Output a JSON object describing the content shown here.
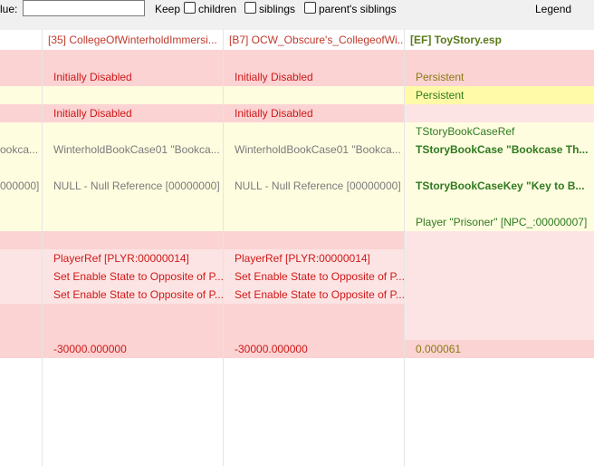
{
  "toolbar": {
    "filter_label": "lue:",
    "filter_value": "",
    "keep_label": "Keep",
    "children_label": "children",
    "siblings_label": "siblings",
    "parents_siblings_label": "parent's siblings",
    "legend_button": "Legend"
  },
  "columns": [
    {
      "label": "[35] CollegeOfWinterholdImmersi...",
      "color": "#c0392b"
    },
    {
      "label": "[B7] OCW_Obscure's_CollegeofWi...",
      "color": "#c0392b"
    },
    {
      "label": "[EF] ToyStory.esp",
      "color": "#5a7a1a"
    }
  ],
  "rows": [
    {
      "bg": "#fbd3d3",
      "cells": [
        "",
        "",
        "",
        ""
      ]
    },
    {
      "bg": "#fbd3d3",
      "cells": [
        "",
        "Initially Disabled",
        "Initially Disabled",
        "Persistent"
      ],
      "styles": [
        "",
        "t-red",
        "t-red",
        "t-olive"
      ],
      "bg3": "#fbd3d3"
    },
    {
      "bg": "#fffde0",
      "cells": [
        "",
        "",
        "",
        "Persistent"
      ],
      "styles": [
        "",
        "",
        "",
        "t-green"
      ],
      "bg3": "#fffaa8"
    },
    {
      "bg": "#fbd3d3",
      "cells": [
        "",
        "Initially Disabled",
        "Initially Disabled",
        ""
      ],
      "styles": [
        "",
        "t-red",
        "t-red",
        ""
      ],
      "bg3": "#fde4e4"
    },
    {
      "bg": "#fffde0",
      "cells": [
        "",
        "",
        "",
        "TStoryBookCaseRef"
      ],
      "styles": [
        "",
        "",
        "",
        "t-green"
      ],
      "bg3": "#fffde0"
    },
    {
      "bg": "#fffde0",
      "cells": [
        "ookca...",
        "WinterholdBookCase01 \"Bookca...",
        "WinterholdBookCase01 \"Bookca...",
        "TStoryBookCase \"Bookcase Th..."
      ],
      "styles": [
        "t-gray",
        "t-gray",
        "t-gray",
        "t-green-b"
      ],
      "bg3": "#fffde0",
      "dotted": true
    },
    {
      "bg": "#fffde0",
      "cells": [
        "",
        "",
        "",
        ""
      ],
      "bg3": "#fffde0"
    },
    {
      "bg": "#fffde0",
      "cells": [
        "000000]",
        "NULL - Null Reference [00000000]",
        "NULL - Null Reference [00000000]",
        "TStoryBookCaseKey \"Key to B..."
      ],
      "styles": [
        "t-gray",
        "t-gray",
        "t-gray",
        "t-green-b"
      ],
      "bg3": "#fffde0",
      "dotted": true
    },
    {
      "bg": "#fffde0",
      "cells": [
        "",
        "",
        "",
        ""
      ],
      "bg3": "#fffde0"
    },
    {
      "bg": "#fffde0",
      "cells": [
        "",
        "",
        "",
        "Player \"Prisoner\" [NPC_:00000007]"
      ],
      "styles": [
        "",
        "",
        "",
        "t-green"
      ],
      "bg3": "#fffde0"
    },
    {
      "bg": "#fbd3d3",
      "cells": [
        "",
        "",
        "",
        ""
      ],
      "bg3": "#fde4e4"
    },
    {
      "bg": "#fde4e4",
      "cells": [
        "",
        "PlayerRef [PLYR:00000014]",
        "PlayerRef [PLYR:00000014]",
        ""
      ],
      "styles": [
        "",
        "t-red",
        "t-red",
        ""
      ],
      "bg3": "#fde4e4"
    },
    {
      "bg": "#fde4e4",
      "cells": [
        "",
        "Set Enable State to Opposite of P...",
        "Set Enable State to Opposite of P...",
        ""
      ],
      "styles": [
        "",
        "t-red",
        "t-red",
        ""
      ],
      "bg3": "#fde4e4"
    },
    {
      "bg": "#fde4e4",
      "cells": [
        "",
        "Set Enable State to Opposite of P...",
        "Set Enable State to Opposite of P...",
        ""
      ],
      "styles": [
        "",
        "t-red",
        "t-red",
        ""
      ],
      "bg3": "#fde4e4"
    },
    {
      "bg": "#fbd3d3",
      "cells": [
        "",
        "",
        "",
        ""
      ],
      "bg3": "#fde4e4"
    },
    {
      "bg": "#fbd3d3",
      "cells": [
        "",
        "",
        "",
        ""
      ],
      "bg3": "#fde4e4"
    },
    {
      "bg": "#fbd3d3",
      "cells": [
        "",
        "-30000.000000",
        "-30000.000000",
        "0.000061"
      ],
      "styles": [
        "",
        "t-red",
        "t-red",
        "t-olive"
      ],
      "bg3": "#fbd3d3"
    }
  ]
}
